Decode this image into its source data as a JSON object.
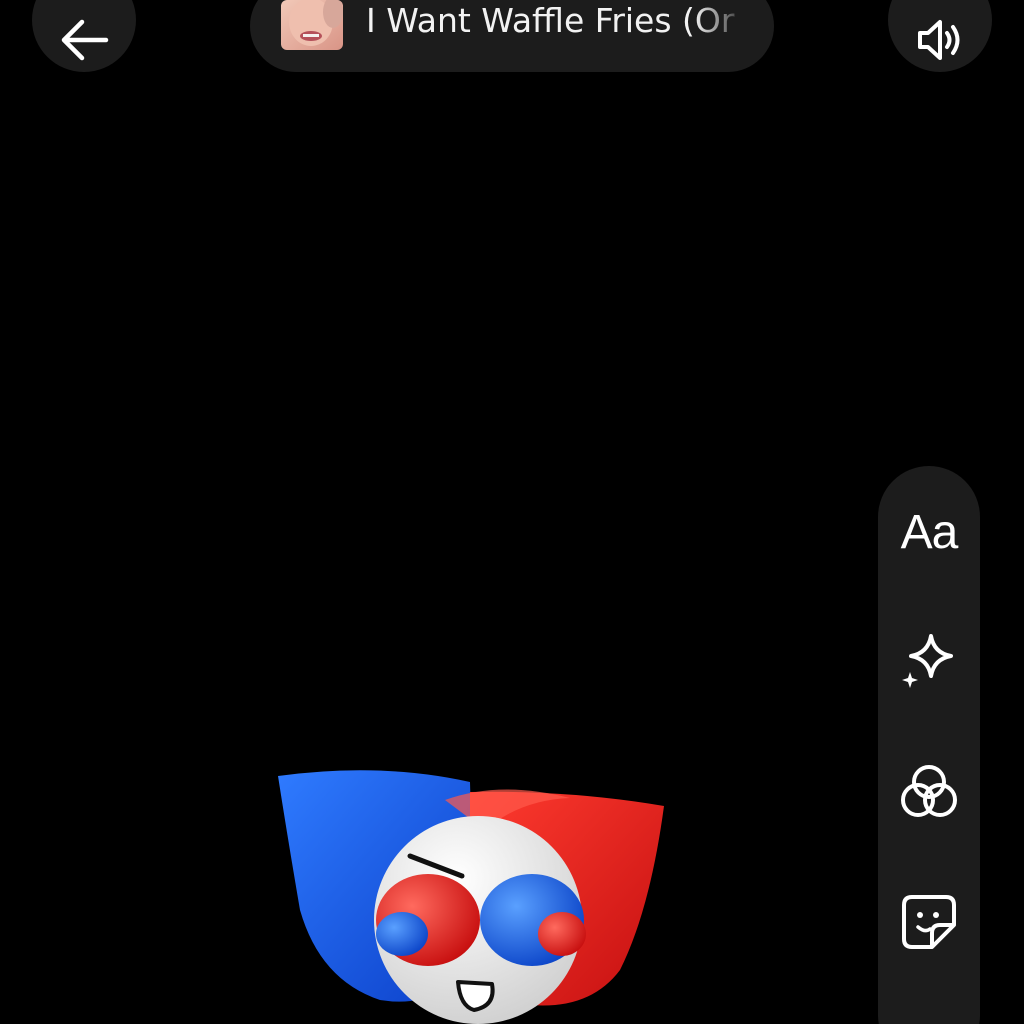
{
  "top_bar": {
    "back_icon": "arrow-left-icon",
    "music": {
      "title": "I Want Waffle Fries (Or",
      "album_art": "album-art-thumbnail"
    },
    "sound_icon": "speaker-icon"
  },
  "tool_rail": {
    "text_tool_label": "Aa",
    "effects_icon": "sparkle-icon",
    "filters_icon": "circles-icon",
    "stickers_icon": "sticker-icon"
  },
  "canvas": {
    "sticker": "jester-emoji-sticker"
  },
  "colors": {
    "background": "#000000",
    "button_bg": "#1c1c1c",
    "icon": "#ffffff",
    "sticker_blue": "#1f5fe0",
    "sticker_red": "#e82020"
  }
}
